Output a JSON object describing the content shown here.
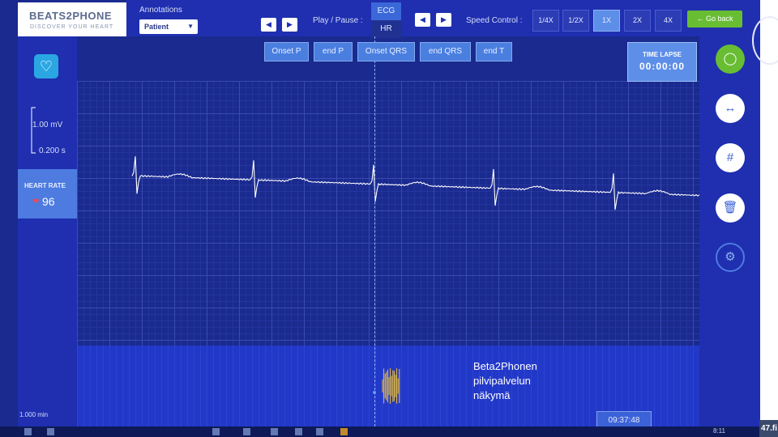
{
  "brand": {
    "name": "BEATS2PHONE",
    "tagline": "DISCOVER YOUR HEART"
  },
  "toolbar": {
    "annotations_label": "Annotations",
    "annotation_select": "Patient",
    "play_pause_label": "Play / Pause :",
    "tab_ecg": "ECG",
    "tab_hr": "HR",
    "speed_label": "Speed Control :",
    "speeds": [
      "1/4X",
      "1/2X",
      "1X",
      "2X",
      "4X"
    ],
    "active_speed": "1X",
    "go_back": "Go back"
  },
  "annotation_buttons": [
    "Onset P",
    "end P",
    "Onset QRS",
    "end QRS",
    "end T"
  ],
  "time_lapse": {
    "label": "TIME LAPSE",
    "value": "00:00:00"
  },
  "scale": {
    "amplitude": "1.00 mV",
    "time": "0.200 s",
    "overview": "1.000 min"
  },
  "heart_rate": {
    "label": "HEART RATE",
    "value": "96"
  },
  "clock": "09:37:48",
  "note": [
    "Beta2Phonen",
    "pilvipalvelun",
    "näkymä"
  ],
  "taskbar_time": "8:11",
  "corner_text": "47.fi",
  "colors": {
    "background": "#1a2a8e",
    "accent": "#5d8ee8",
    "go_back": "#68bd33",
    "trace": "#ffffff",
    "overview_trace": "#f2c335"
  }
}
